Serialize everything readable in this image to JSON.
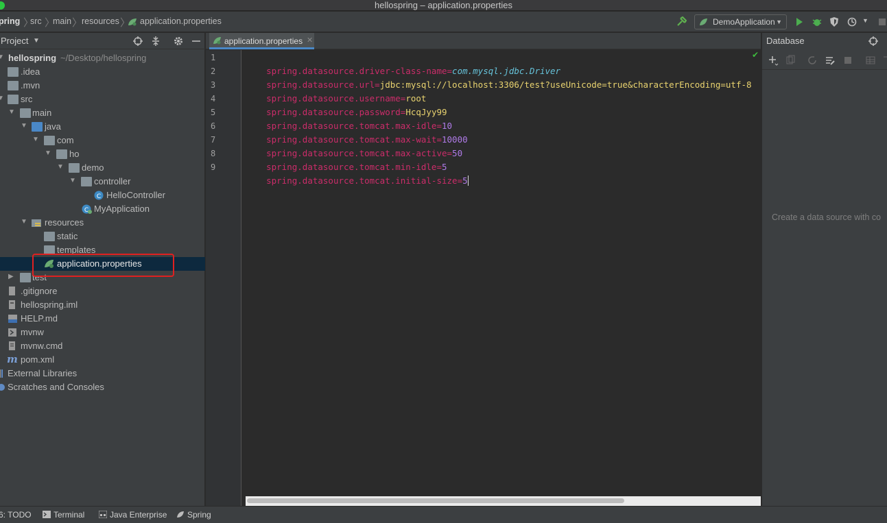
{
  "window": {
    "title": "hellospring – application.properties"
  },
  "breadcrumb": [
    "pring",
    "src",
    "main",
    "resources",
    "application.properties"
  ],
  "toolbar": {
    "run_config": "DemoApplication"
  },
  "project_panel": {
    "title": "Project",
    "tree": [
      {
        "label": "hellospring",
        "path": "~/Desktop/hellospring"
      },
      {
        "label": ".idea"
      },
      {
        "label": ".mvn"
      },
      {
        "label": "src"
      },
      {
        "label": "main"
      },
      {
        "label": "java"
      },
      {
        "label": "com"
      },
      {
        "label": "ho"
      },
      {
        "label": "demo"
      },
      {
        "label": "controller"
      },
      {
        "label": "HelloController"
      },
      {
        "label": "MyApplication"
      },
      {
        "label": "resources"
      },
      {
        "label": "static"
      },
      {
        "label": "templates"
      },
      {
        "label": "application.properties"
      },
      {
        "label": "test"
      },
      {
        "label": ".gitignore"
      },
      {
        "label": "hellospring.iml"
      },
      {
        "label": "HELP.md"
      },
      {
        "label": "mvnw"
      },
      {
        "label": "mvnw.cmd"
      },
      {
        "label": "pom.xml"
      },
      {
        "label": "External Libraries"
      },
      {
        "label": "Scratches and Consoles"
      }
    ]
  },
  "editor": {
    "tab_label": "application.properties",
    "line_numbers": [
      "1",
      "2",
      "3",
      "4",
      "5",
      "6",
      "7",
      "8",
      "9"
    ],
    "lines": [
      {
        "key": "spring.datasource.driver-class-name",
        "value": "com.mysql.jdbc.Driver"
      },
      {
        "key": "spring.datasource.url",
        "value": "jdbc:mysql://localhost:3306/test?useUnicode=true&characterEncoding=utf-8"
      },
      {
        "key": "spring.datasource.username",
        "value": "root"
      },
      {
        "key": "spring.datasource.password",
        "value": "HcqJyy99"
      },
      {
        "key": "spring.datasource.tomcat.max-idle",
        "value": "10"
      },
      {
        "key": "spring.datasource.tomcat.max-wait",
        "value": "10000"
      },
      {
        "key": "spring.datasource.tomcat.max-active",
        "value": "50"
      },
      {
        "key": "spring.datasource.tomcat.min-idle",
        "value": "5"
      },
      {
        "key": "spring.datasource.tomcat.initial-size",
        "value": "5"
      }
    ],
    "equals": "="
  },
  "database_panel": {
    "title": "Database",
    "empty_text": "Create a data source with co"
  },
  "bottom_bar": {
    "todo": "6: TODO",
    "terminal": "Terminal",
    "java_enterprise": "Java Enterprise",
    "spring": "Spring"
  },
  "colors": {
    "key": "#cc2c6a",
    "string_value": "#e9d36f",
    "number_value": "#b07be8",
    "class_name": "#66c2d9",
    "selection": "#0d293e",
    "highlight_box": "#e02020"
  }
}
